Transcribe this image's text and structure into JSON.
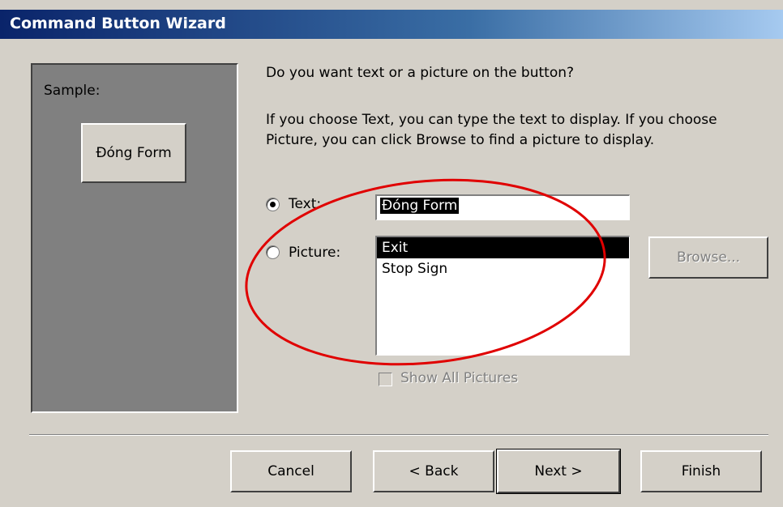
{
  "window": {
    "title": "Command Button Wizard"
  },
  "sample": {
    "label": "Sample:",
    "button_text": "Đóng Form"
  },
  "prompt": {
    "question": "Do you want text or a picture on the button?",
    "explanation": "If you choose Text, you can type the text to display.  If you choose Picture, you can click Browse to find a picture to display."
  },
  "options": {
    "text_label": "Text:",
    "text_value": "Đóng Form",
    "picture_label": "Picture:",
    "selected": "text"
  },
  "picture_list": {
    "items": [
      "Exit",
      "Stop Sign"
    ],
    "selected_index": 0
  },
  "browse_button": "Browse...",
  "show_all_pictures": {
    "label": "Show All Pictures",
    "checked": false,
    "enabled": false
  },
  "footer": {
    "cancel": "Cancel",
    "back": "< Back",
    "next": "Next >",
    "finish": "Finish"
  },
  "annotation_color": "#e00000"
}
